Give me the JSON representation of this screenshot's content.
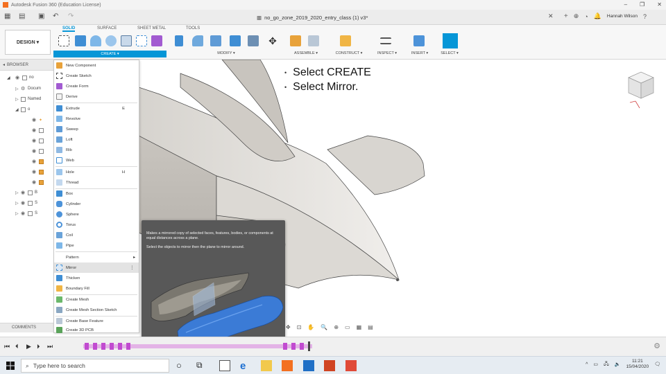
{
  "titlebar": {
    "title": "Autodesk Fusion 360 (Education License)"
  },
  "filebar": {
    "doc_title": "no_go_zone_2019_2020_entry_class (1) v3*",
    "user": "Hannah Wilson"
  },
  "toolbar": {
    "design_label": "DESIGN ▾",
    "tabs": [
      "SOLID",
      "SURFACE",
      "SHEET METAL",
      "TOOLS"
    ],
    "groups": [
      "CREATE ▾",
      "MODIFY ▾",
      "ASSEMBLE ▾",
      "CONSTRUCT ▾",
      "INSPECT ▾",
      "INSERT ▾",
      "SELECT ▾"
    ]
  },
  "browser": {
    "header": "BROWSER",
    "rows": [
      "no",
      "Docum",
      "Named",
      "o",
      "",
      "",
      "",
      "",
      "",
      "",
      "",
      "",
      "B",
      "S",
      "S",
      "S"
    ],
    "comments": "COMMENTS"
  },
  "instructions": [
    "Select CREATE",
    "Select Mirror."
  ],
  "menu": {
    "items": [
      {
        "label": "New Component",
        "key": ""
      },
      {
        "label": "Create Sketch",
        "key": ""
      },
      {
        "label": "Create Form",
        "key": ""
      },
      {
        "label": "Derive",
        "key": ""
      },
      {
        "label": "Extrude",
        "key": "E"
      },
      {
        "label": "Revolve",
        "key": ""
      },
      {
        "label": "Sweep",
        "key": ""
      },
      {
        "label": "Loft",
        "key": ""
      },
      {
        "label": "Rib",
        "key": ""
      },
      {
        "label": "Web",
        "key": ""
      },
      {
        "label": "Hole",
        "key": "H"
      },
      {
        "label": "Thread",
        "key": ""
      },
      {
        "label": "Box",
        "key": ""
      },
      {
        "label": "Cylinder",
        "key": ""
      },
      {
        "label": "Sphere",
        "key": ""
      },
      {
        "label": "Torus",
        "key": ""
      },
      {
        "label": "Coil",
        "key": ""
      },
      {
        "label": "Pipe",
        "key": ""
      },
      {
        "label": "Pattern",
        "key": "▸"
      },
      {
        "label": "Mirror",
        "key": "⋮"
      },
      {
        "label": "Thicken",
        "key": ""
      },
      {
        "label": "Boundary Fill",
        "key": ""
      },
      {
        "label": "Create Mesh",
        "key": ""
      },
      {
        "label": "Create Mesh Section Sketch",
        "key": ""
      },
      {
        "label": "Create Base Feature",
        "key": ""
      },
      {
        "label": "Create 3D PCB",
        "key": ""
      }
    ]
  },
  "tooltip": {
    "line1": "Makes a mirrored copy of selected faces, features, bodies, or components at equal distances across a plane.",
    "line2": "Select the objects to mirror then the plane to mirror around."
  },
  "taskbar": {
    "search_placeholder": "Type here to search",
    "time": "11:21",
    "date": "15/04/2020"
  },
  "colors": {
    "accent": "#0696d7",
    "model": "#e4e1dd",
    "tooltip_bg": "#585858"
  }
}
